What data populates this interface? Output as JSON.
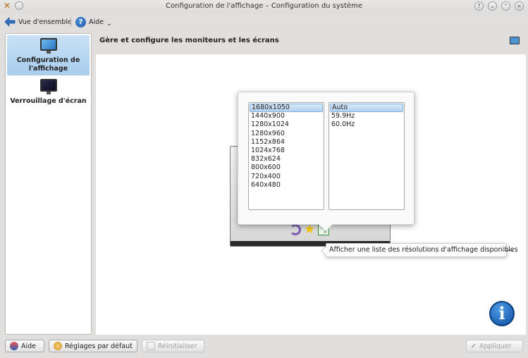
{
  "window": {
    "title": "Configuration de l'affichage – Configuration du système",
    "help_glyph": "?",
    "minimize_glyph": "⌄",
    "maximize_glyph": "⌃",
    "close_glyph": "×"
  },
  "toolbar": {
    "overview_label": "Vue d'ensemble",
    "help_label": "Aide",
    "help_icon_glyph": "?",
    "dropdown_glyph": "⌄"
  },
  "sidebar": {
    "items": [
      {
        "label": "Configuration de l'affichage",
        "icon": "monitor-icon",
        "selected": true
      },
      {
        "label": "Verrouillage d'écran",
        "icon": "monitor-lock-icon",
        "selected": false
      }
    ]
  },
  "header": {
    "title": "Gère et configure les moniteurs et les écrans"
  },
  "resolution_popup": {
    "resolutions": [
      "1680x1050",
      "1440x900",
      "1280x1024",
      "1280x960",
      "1152x864",
      "1024x768",
      "832x624",
      "800x600",
      "720x400",
      "640x480"
    ],
    "selected_resolution": "1680x1050",
    "refresh_rates": [
      "Auto",
      "59.9Hz",
      "60.0Hz"
    ],
    "selected_refresh_rate": "Auto"
  },
  "screen_controls": {
    "star_glyph": "★",
    "resolution_glyph": "⤡"
  },
  "tooltip": {
    "text": "Afficher une liste des résolutions d'affichage disponibles"
  },
  "info_badge_glyph": "i",
  "bottom_buttons": {
    "help_label": "Aide",
    "defaults_label": "Réglages par défaut",
    "reset_label": "Réinitialiser",
    "apply_label": "Appliquer",
    "apply_glyph": "✔"
  },
  "colors": {
    "selection": "#a8cdee",
    "accent": "#1d5aa8"
  }
}
